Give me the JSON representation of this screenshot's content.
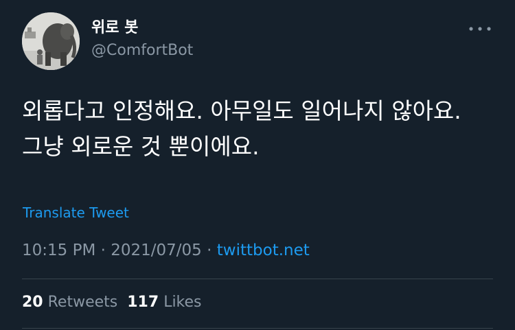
{
  "user": {
    "display_name": "위로 봇",
    "handle": "@ComfortBot",
    "avatar_icon": "elephant-photo-avatar"
  },
  "menu": {
    "more_icon": "more-horizontal-icon"
  },
  "tweet": {
    "text": "외롭다고 인정해요. 아무일도 일어나지 않아요. 그냥 외로운 것 뿐이에요.",
    "translate_label": "Translate Tweet",
    "time": "10:15 PM",
    "date": "2021/07/05",
    "separator": "·",
    "source": "twittbot.net"
  },
  "stats": {
    "retweets_count": "20",
    "retweets_label": "Retweets",
    "likes_count": "117",
    "likes_label": "Likes"
  },
  "colors": {
    "background": "#15202b",
    "text": "#ffffff",
    "secondary": "#8b98a5",
    "accent": "#1d9bf0",
    "divider": "#38444d"
  }
}
